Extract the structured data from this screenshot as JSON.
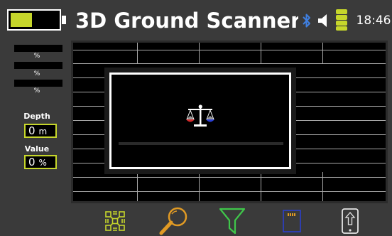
{
  "header": {
    "title": "3D Ground Scanner",
    "time": "18:46",
    "battery_level": 0.45,
    "signal_level": 1.0
  },
  "left_panel": {
    "meters": [
      {
        "label": "%",
        "level": 0
      },
      {
        "label": "%",
        "level": 0
      },
      {
        "label": "%",
        "level": 0
      }
    ],
    "depth": {
      "label": "Depth",
      "value": "0",
      "unit": "m"
    },
    "value": {
      "label": "Value",
      "value": "0",
      "unit": "%"
    }
  },
  "dialog": {
    "icon": "balance-scale-icon",
    "progress": 0
  },
  "toolbar": {
    "items": [
      {
        "icon": "grid-pattern-icon"
      },
      {
        "icon": "magnifier-icon"
      },
      {
        "icon": "filter-funnel-icon"
      },
      {
        "icon": "sd-card-icon"
      },
      {
        "icon": "phone-upload-icon"
      }
    ]
  },
  "colors": {
    "accent": "#c6d62b",
    "background": "#3a3a3a",
    "panel": "#000000",
    "grid": "#a8a8a8",
    "scale_left": "#d42a2a",
    "scale_right": "#2a3fd4"
  }
}
